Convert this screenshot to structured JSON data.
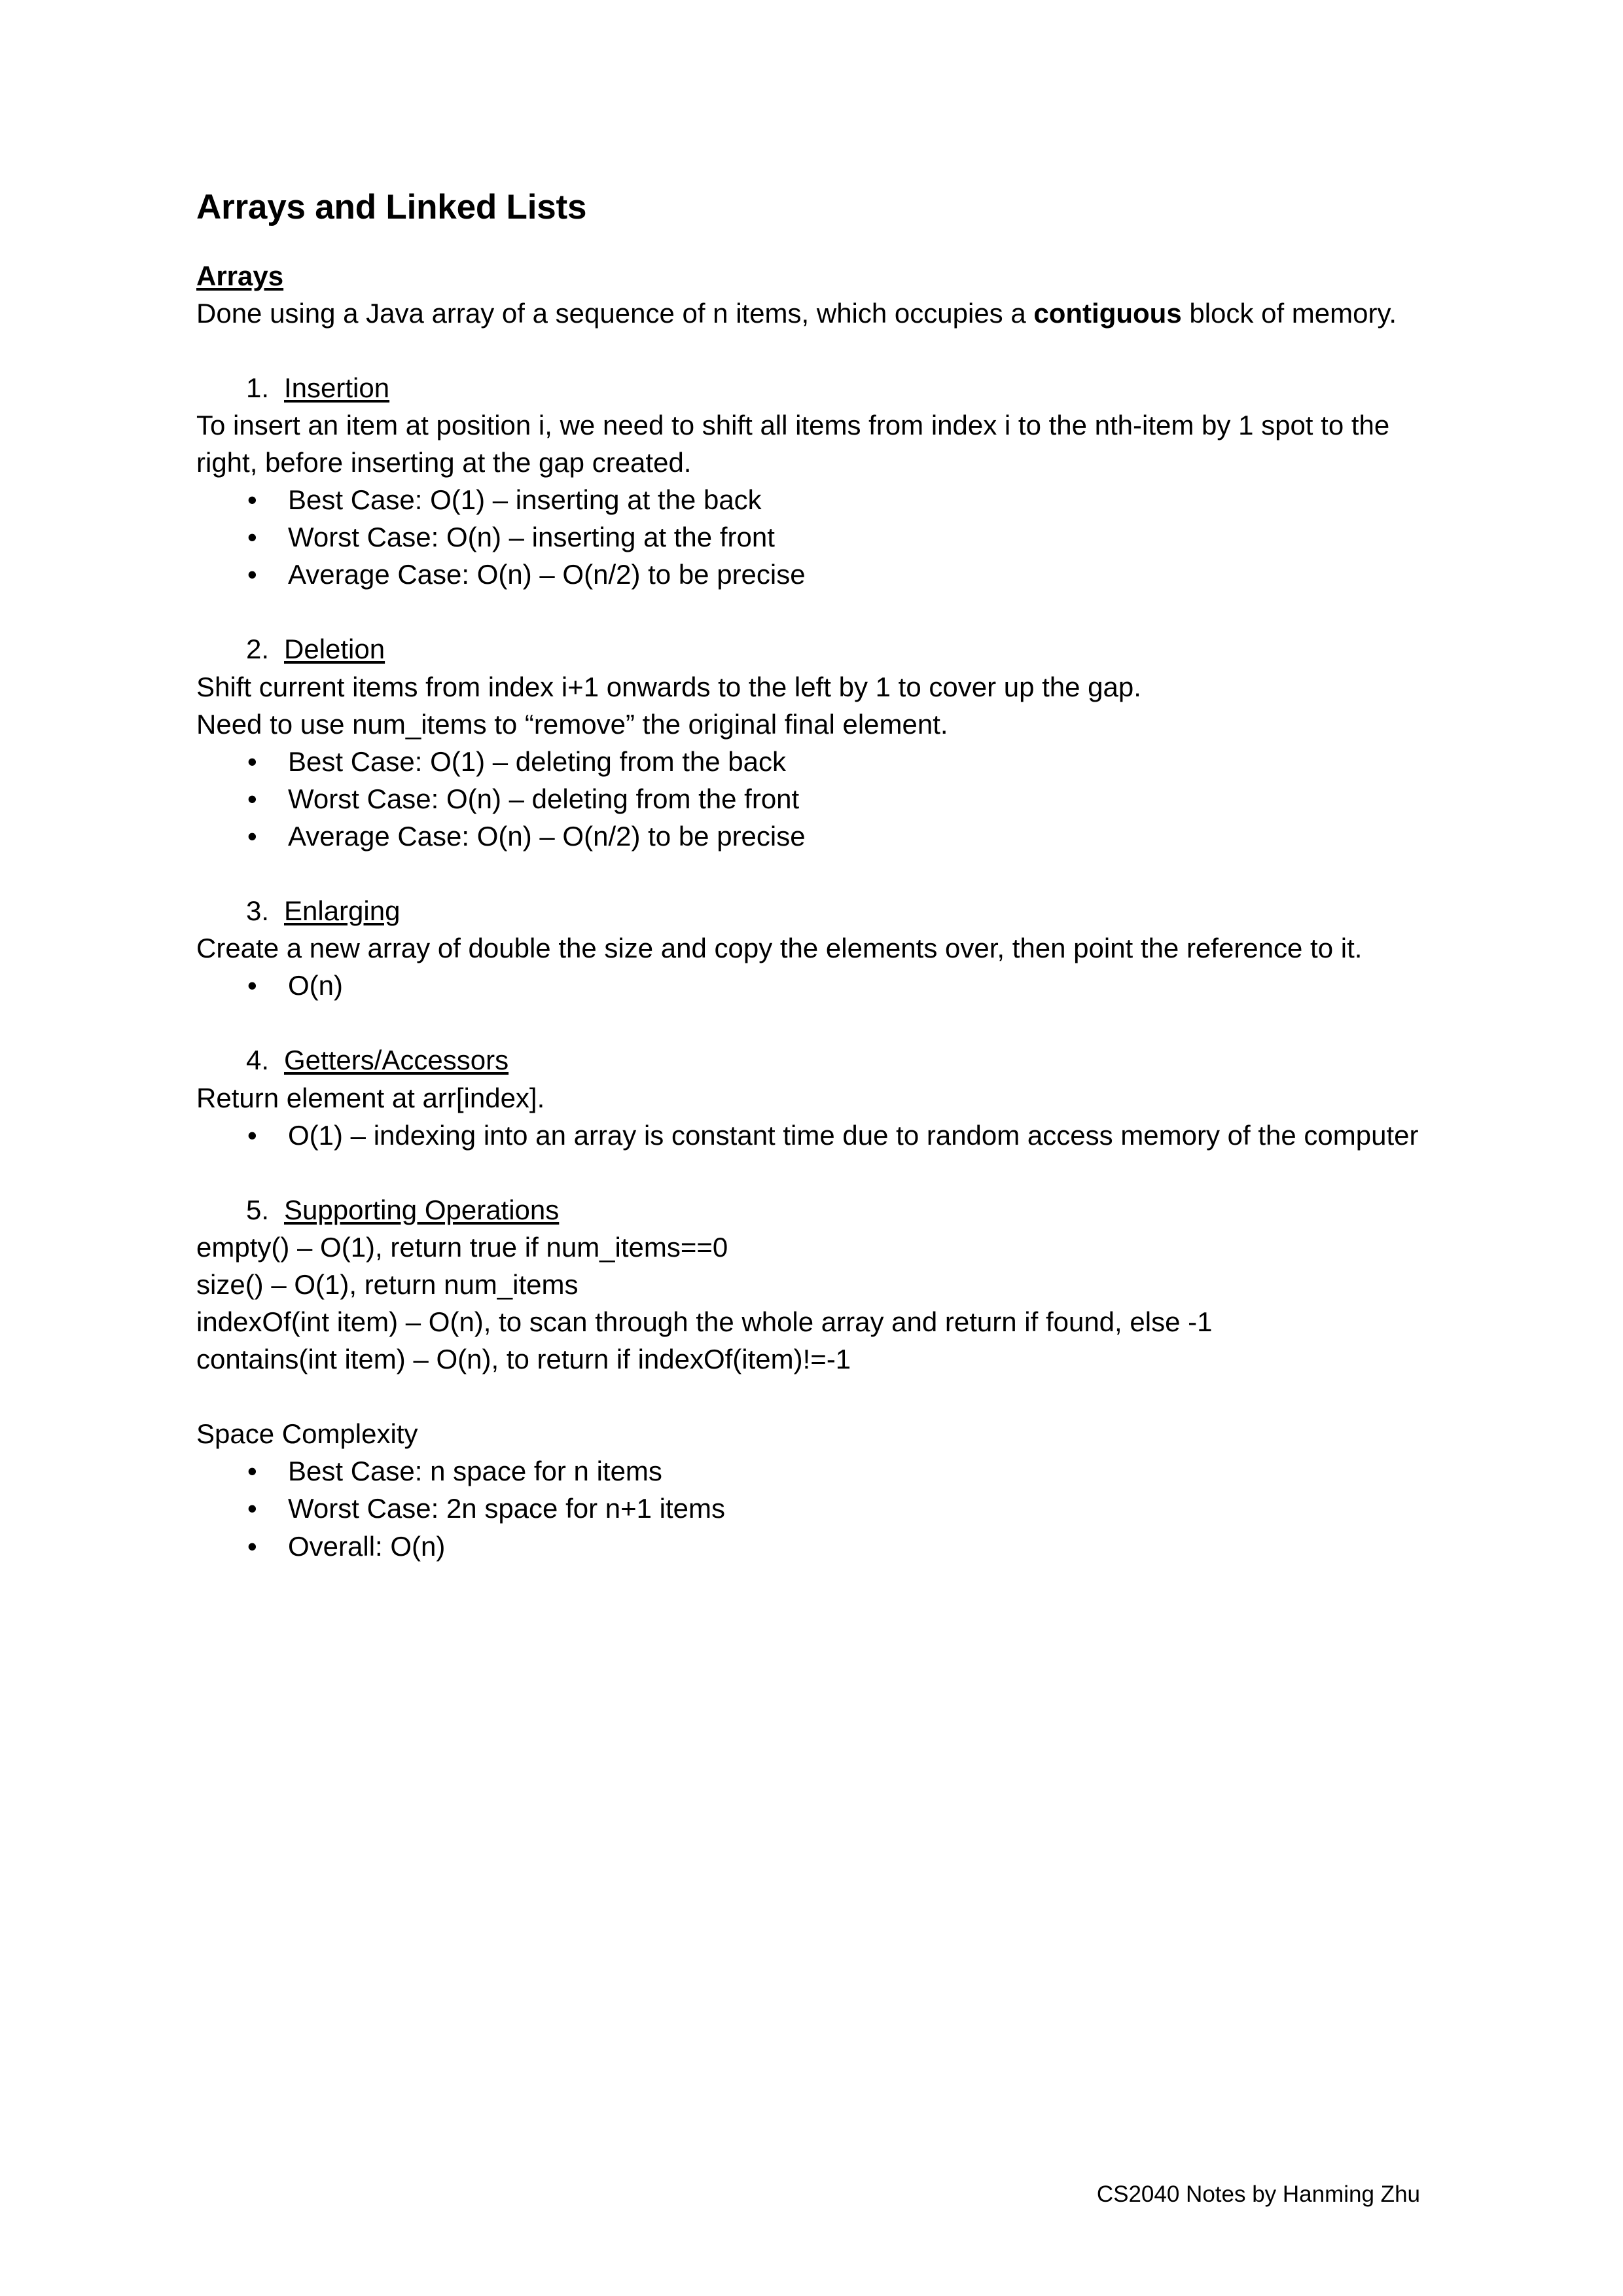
{
  "document": {
    "title": "Arrays and Linked Lists",
    "footer": "CS2040 Notes by Hanming Zhu"
  },
  "sections": [
    {
      "heading": "Arrays",
      "intro_prefix": "Done using a Java array of a sequence of n items, which occupies a ",
      "intro_bold": "contiguous",
      "intro_suffix": " block of memory."
    }
  ],
  "items": [
    {
      "number": "1.",
      "label": "Insertion",
      "body": "To insert an item at position i, we need to shift all items from index i to the nth-item by 1 spot to the right, before inserting at the gap created.",
      "bullets": [
        "Best Case: O(1) – inserting at the back",
        "Worst Case: O(n) – inserting at the front",
        "Average Case: O(n) – O(n/2) to be precise"
      ]
    },
    {
      "number": "2.",
      "label": "Deletion",
      "body_line1": "Shift current items from index i+1 onwards to the left by 1 to cover up the gap.",
      "body_line2": "Need to use num_items to “remove” the original final element.",
      "bullets": [
        "Best Case: O(1) – deleting from the back",
        "Worst Case: O(n) – deleting from the front",
        "Average Case: O(n) – O(n/2) to be precise"
      ]
    },
    {
      "number": "3.",
      "label": "Enlarging",
      "body": "Create a new array of double the size and copy the elements over, then point the reference to it.",
      "bullets": [
        "O(n)"
      ]
    },
    {
      "number": "4.",
      "label": "Getters/Accessors",
      "body": "Return element at arr[index].",
      "bullets": [
        "O(1) – indexing into an array is constant time due to random access memory of the computer"
      ]
    },
    {
      "number": "5.",
      "label": "Supporting Operations",
      "lines": [
        "empty() – O(1), return true if num_items==0",
        "size() – O(1), return num_items",
        "indexOf(int item) – O(n), to scan through the whole array and return if found, else -1",
        "contains(int item) – O(n), to return if indexOf(item)!=-1"
      ]
    }
  ],
  "space_complexity": {
    "heading": "Space Complexity",
    "bullets": [
      "Best Case: n space for n items",
      "Worst Case: 2n space for n+1 items",
      "Overall: O(n)"
    ]
  },
  "glyphs": {
    "bullet": "•"
  }
}
